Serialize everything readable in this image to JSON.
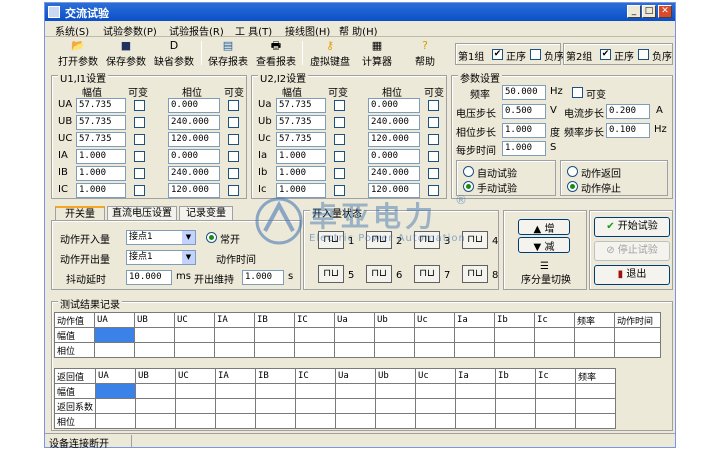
{
  "window": {
    "title": "交流试验",
    "status": "设备连接断开"
  },
  "menu": [
    "系统(S)",
    "试验参数(P)",
    "试验报告(R)",
    "工 具(T)",
    "接线图(H)",
    "帮 助(H)"
  ],
  "toolbar": [
    "打开参数",
    "保存参数",
    "缺省参数",
    "保存报表",
    "查看报表",
    "虚拟键盘",
    "计算器",
    "帮助"
  ],
  "groups_top": {
    "g1": "第1组",
    "g2": "第2组",
    "zheng": "正序",
    "fu": "负序"
  },
  "u1": {
    "title": "U1,I1设置",
    "col_amp": "幅值",
    "col_var": "可变",
    "col_phase": "相位",
    "col_var2": "可变",
    "rows": [
      {
        "name": "UA",
        "amp": "57.735",
        "phase": "0.000"
      },
      {
        "name": "UB",
        "amp": "57.735",
        "phase": "240.000"
      },
      {
        "name": "UC",
        "amp": "57.735",
        "phase": "120.000"
      },
      {
        "name": "IA",
        "amp": "1.000",
        "phase": "0.000"
      },
      {
        "name": "IB",
        "amp": "1.000",
        "phase": "240.000"
      },
      {
        "name": "IC",
        "amp": "1.000",
        "phase": "120.000"
      }
    ]
  },
  "u2": {
    "title": "U2,I2设置",
    "col_amp": "幅值",
    "col_var": "可变",
    "col_phase": "相位",
    "col_var2": "可变",
    "rows": [
      {
        "name": "Ua",
        "amp": "57.735",
        "phase": "0.000"
      },
      {
        "name": "Ub",
        "amp": "57.735",
        "phase": "240.000"
      },
      {
        "name": "Uc",
        "amp": "57.735",
        "phase": "120.000"
      },
      {
        "name": "Ia",
        "amp": "1.000",
        "phase": "0.000"
      },
      {
        "name": "Ib",
        "amp": "1.000",
        "phase": "240.000"
      },
      {
        "name": "Ic",
        "amp": "1.000",
        "phase": "120.000"
      }
    ]
  },
  "params": {
    "title": "参数设置",
    "freq_label": "频率",
    "freq": "50.000",
    "freq_unit": "Hz",
    "var_label": "可变",
    "vstep_label": "电压步长",
    "vstep": "0.500",
    "vstep_unit": "V",
    "istep_label": "电流步长",
    "istep": "0.200",
    "istep_unit": "A",
    "pstep_label": "相位步长",
    "pstep": "1.000",
    "pstep_unit": "度",
    "fstep_label": "频率步长",
    "fstep": "0.100",
    "fstep_unit": "Hz",
    "time_label": "每步时间",
    "time": "1.000",
    "time_unit": "S",
    "auto": "自动试验",
    "manual": "手动试验",
    "ret": "动作返回",
    "stop": "动作停止"
  },
  "tabs": [
    "开关量",
    "直流电压设置",
    "记录变量"
  ],
  "switch": {
    "in_label": "动作开入量",
    "in_value": "接点1",
    "out_label": "动作开出量",
    "out_value": "接点1",
    "jitter_label": "抖动延时",
    "jitter": "10.000",
    "jitter_unit": "ms",
    "hold_label": "开出维持",
    "hold": "1.000",
    "hold_unit": "s",
    "normal_label": "常开",
    "act_time_label": "动作时间"
  },
  "kairu": {
    "title": "开入量状态",
    "nums": [
      "1",
      "2",
      "3",
      "4",
      "5",
      "6",
      "7",
      "8"
    ]
  },
  "controls": {
    "inc": "增",
    "dec": "减",
    "seq": "序分量切换",
    "start": "开始试验",
    "stop": "停止试验",
    "exit": "退出"
  },
  "results": {
    "title": "测试结果记录",
    "cols": [
      "UA",
      "UB",
      "UC",
      "IA",
      "IB",
      "IC",
      "Ua",
      "Ub",
      "Uc",
      "Ia",
      "Ib",
      "Ic",
      "频率",
      "动作时间"
    ],
    "t1_head": "动作值",
    "t1_rows": [
      "幅值",
      "相位"
    ],
    "t2_head": "返回值",
    "t2_rows": [
      "幅值",
      "返回系数",
      "相位"
    ]
  },
  "watermark": {
    "cn": "卓亚电力",
    "en": "Electric Power Automation",
    "reg": "®"
  },
  "colors": {
    "title_bar": "#0b4fc8",
    "selected_cell": "#3a82e8",
    "radio_dot": "#1a8a1a"
  }
}
